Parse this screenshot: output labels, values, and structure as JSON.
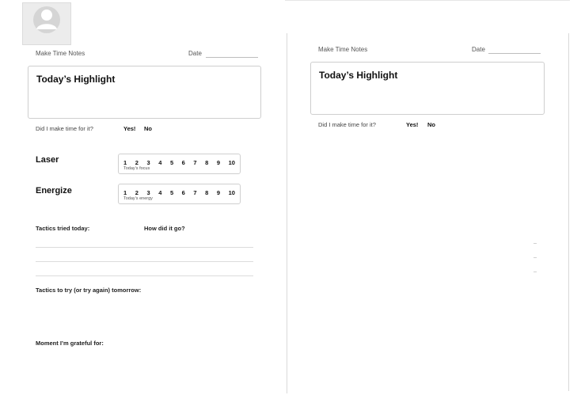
{
  "left": {
    "app_title": "Make Time Notes",
    "date_label": "Date",
    "highlight_title": "Today’s Highlight",
    "question": "Did I make time for it?",
    "yes": "Yes!",
    "no": "No",
    "laser": {
      "label": "Laser",
      "scale": [
        "1",
        "2",
        "3",
        "4",
        "5",
        "6",
        "7",
        "8",
        "9",
        "10"
      ],
      "caption": "Today’s focus"
    },
    "energize": {
      "label": "Energize",
      "scale": [
        "1",
        "2",
        "3",
        "4",
        "5",
        "6",
        "7",
        "8",
        "9",
        "10"
      ],
      "caption": "Today’s energy"
    },
    "tactics_tried": "Tactics tried today:",
    "how_did_it_go": "How did it go?",
    "tactics_tomorrow": "Tactics to try (or try again) tomorrow:",
    "grateful": "Moment I’m grateful for:"
  },
  "right": {
    "app_title": "Make Time Notes",
    "date_label": "Date",
    "highlight_title": "Today’s Highlight",
    "question": "Did I make time for it?",
    "yes": "Yes!",
    "no": "No"
  }
}
